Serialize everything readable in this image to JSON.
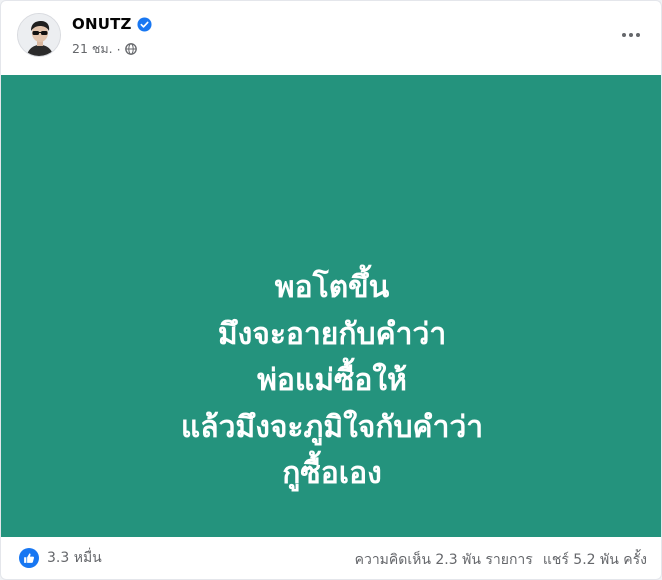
{
  "post": {
    "author": "ONUTZ",
    "verified": true,
    "time": "21 ชม.",
    "time_separator": "·",
    "audience_icon": "globe-icon",
    "more_icon": "more-horizontal-icon"
  },
  "image": {
    "background_color": "#24937d",
    "lines": [
      "พอโตขึ้น",
      "มึงจะอายกับคำว่า",
      "พ่อแม่ซื้อให้",
      "แล้วมึงจะภูมิใจกับคำว่า",
      "กูซื้อเอง"
    ]
  },
  "footer": {
    "reaction_icon": "like-icon",
    "reaction_count": "3.3 หมื่น",
    "comments": "ความคิดเห็น 2.3 พัน รายการ",
    "shares": "แชร์ 5.2 พัน ครั้ง"
  },
  "colors": {
    "accent": "#1877f2",
    "post_background": "#24937d",
    "secondary_text": "#65676b"
  }
}
